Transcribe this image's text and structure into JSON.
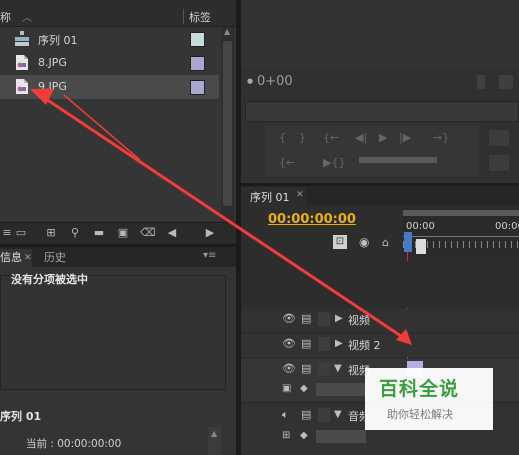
{
  "project_panel": {
    "col_name": "称",
    "col_tag": "标签",
    "items": [
      {
        "label": "序列 01",
        "icon": "sequence-icon",
        "color": "#c6dcd8"
      },
      {
        "label": "8.JPG",
        "icon": "image-file-icon",
        "color": "#a9a6cf"
      },
      {
        "label": "9.JPG",
        "icon": "image-file-icon",
        "color": "#a9a6cf"
      }
    ]
  },
  "info_panel": {
    "tabs": [
      "信息",
      "历史"
    ],
    "message": "没有分项被选中",
    "sequence_name": "序列 01",
    "current_label": "当前 : 00:00:00:00"
  },
  "monitor": {
    "timecode": "0+00"
  },
  "timeline": {
    "tab_label": "序列 01",
    "timecode": "00:00:00:00",
    "ruler_labels": [
      "00:00",
      "00:00"
    ],
    "tracks": [
      {
        "label": "视频"
      },
      {
        "label": "视频 2"
      },
      {
        "label": "视频"
      },
      {
        "label": "音频"
      }
    ]
  },
  "watermark": {
    "title": "百科全说",
    "subtitle": "助你轻松解决"
  },
  "colors": {
    "arrow": "#f23c37",
    "timecode": "#e8b014",
    "playhead": "#c4382c"
  }
}
